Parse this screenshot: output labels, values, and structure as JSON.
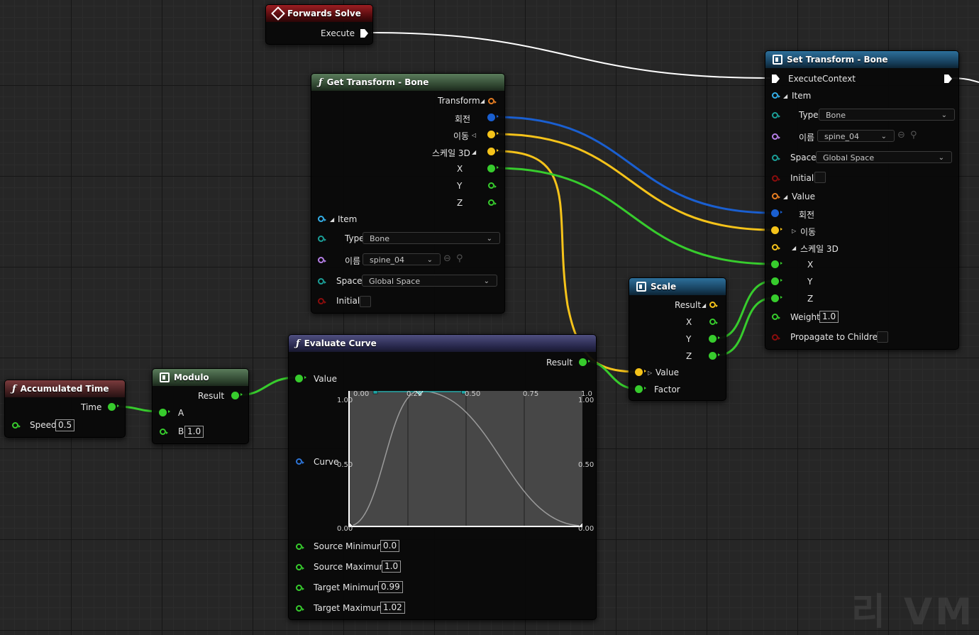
{
  "colors": {
    "exec": "#ffffff",
    "float": "#37cc2d",
    "struct_orange": "#e67d22",
    "rotation_blue": "#1a5fd0",
    "vector_yellow": "#f5c31a",
    "name_purple": "#b57fe6",
    "enum_teal": "#1b9e97",
    "element_blue": "#34aee6",
    "bool_red": "#8b0d0d",
    "curve_blue": "#2d74d6"
  },
  "forwards_solve": {
    "title": "Forwards Solve",
    "icon": "diamond-event-icon",
    "execute": "Execute"
  },
  "get_transform": {
    "title": "Get Transform - Bone",
    "icon": "function-icon",
    "transform": "Transform",
    "rotation": "회전",
    "translation": "이동",
    "scale3d": "스케일 3D",
    "x": "X",
    "y": "Y",
    "z": "Z",
    "item": "Item",
    "type_label": "Type",
    "type_value": "Bone",
    "name_label": "이름",
    "name_value": "spine_04",
    "space_label": "Space",
    "space_value": "Global Space",
    "initial_label": "Initial"
  },
  "set_transform": {
    "title": "Set Transform - Bone",
    "icon": "mutable-node-icon",
    "execute_context": "ExecuteContext",
    "item": "Item",
    "type_label": "Type",
    "type_value": "Bone",
    "name_label": "이름",
    "name_value": "spine_04",
    "space_label": "Space",
    "space_value": "Global Space",
    "initial_label": "Initial",
    "value_label": "Value",
    "rotation": "회전",
    "translation": "이동",
    "scale3d": "스케일 3D",
    "x": "X",
    "y": "Y",
    "z": "Z",
    "weight_label": "Weight",
    "weight_value": "1.0",
    "propagate_label": "Propagate to Children"
  },
  "scale": {
    "title": "Scale",
    "icon": "mutable-node-icon",
    "result": "Result",
    "x": "X",
    "y": "Y",
    "z": "Z",
    "value": "Value",
    "factor": "Factor"
  },
  "accumulated_time": {
    "title": "Accumulated Time",
    "icon": "function-icon",
    "time": "Time",
    "speed_label": "Speed",
    "speed_value": "0.5"
  },
  "modulo": {
    "title": "Modulo",
    "icon": "mutable-node-icon",
    "result": "Result",
    "a": "A",
    "b": "B",
    "b_value": "1.0"
  },
  "evaluate_curve": {
    "title": "Evaluate Curve",
    "icon": "function-icon",
    "value": "Value",
    "result": "Result",
    "curve": "Curve",
    "source_min_label": "Source Minimum",
    "source_min_value": "0.0",
    "source_max_label": "Source Maximum",
    "source_max_value": "1.0",
    "target_min_label": "Target Minimum",
    "target_min_value": "0.99",
    "target_max_label": "Target Maximum",
    "target_max_value": "1.02",
    "curve_top_labels": [
      "0.00",
      "0.25",
      "0.50",
      "0.75",
      "1.0"
    ],
    "curve_left_labels": [
      "1.00",
      "0.50",
      "0.00"
    ],
    "curve_right_labels": [
      "1.00",
      "0.50",
      "0.00"
    ],
    "curve_keys": [
      {
        "x": 0.0,
        "y": 0.0
      },
      {
        "x": 0.3,
        "y": 1.0
      },
      {
        "x": 1.0,
        "y": 0.0
      }
    ]
  },
  "watermark": "리 VM"
}
